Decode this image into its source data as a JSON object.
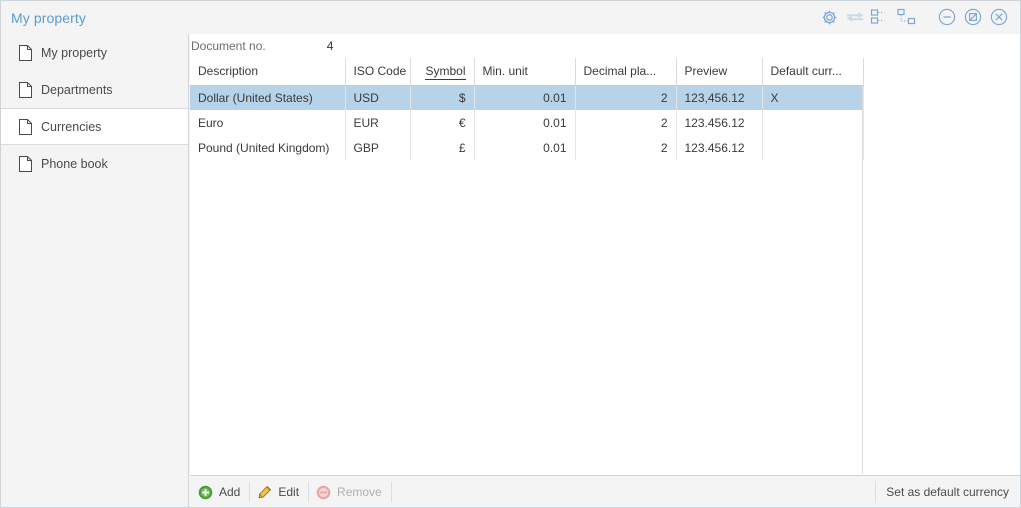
{
  "window": {
    "title": "My property",
    "title_color": "#5b9bd5",
    "controls": [
      {
        "name": "settings-gear-icon",
        "label": "Settings"
      },
      {
        "name": "transfer-arrows-icon",
        "label": "Transfer"
      },
      {
        "name": "layout-tiles-icon",
        "label": "Layout"
      },
      {
        "name": "layout-diagram-icon",
        "label": "Diagram"
      },
      {
        "name": "minimize-icon",
        "label": "Minimize"
      },
      {
        "name": "restore-icon",
        "label": "Restore"
      },
      {
        "name": "close-icon",
        "label": "Close"
      }
    ]
  },
  "sidebar": {
    "items": [
      {
        "label": "My property",
        "selected": false
      },
      {
        "label": "Departments",
        "selected": false
      },
      {
        "label": "Currencies",
        "selected": true
      },
      {
        "label": "Phone book",
        "selected": false
      }
    ]
  },
  "content": {
    "document_no_label": "Document no.",
    "document_no_value": "4",
    "table": {
      "columns": [
        {
          "label": "Description",
          "align": "left",
          "sorted": false
        },
        {
          "label": "ISO Code",
          "align": "left",
          "sorted": false
        },
        {
          "label": "Symbol",
          "align": "right",
          "sorted": true
        },
        {
          "label": "Min. unit",
          "align": "right",
          "sorted": false
        },
        {
          "label": "Decimal pla...",
          "align": "right",
          "sorted": false
        },
        {
          "label": "Preview",
          "align": "left",
          "sorted": false
        },
        {
          "label": "Default curr...",
          "align": "left",
          "sorted": false
        }
      ],
      "rows": [
        {
          "selected": true,
          "cells": [
            "Dollar (United States)",
            "USD",
            "$",
            "0.01",
            "2",
            "123,456.12",
            "X"
          ]
        },
        {
          "selected": false,
          "cells": [
            "Euro",
            "EUR",
            "€",
            "0.01",
            "2",
            "123.456.12",
            ""
          ]
        },
        {
          "selected": false,
          "cells": [
            "Pound (United Kingdom)",
            "GBP",
            "£",
            "0.01",
            "2",
            "123.456.12",
            ""
          ]
        }
      ]
    },
    "selection_color": "#b6d3e9"
  },
  "footer": {
    "add_label": "Add",
    "edit_label": "Edit",
    "remove_label": "Remove",
    "remove_disabled": true,
    "set_default_label": "Set as default currency"
  }
}
